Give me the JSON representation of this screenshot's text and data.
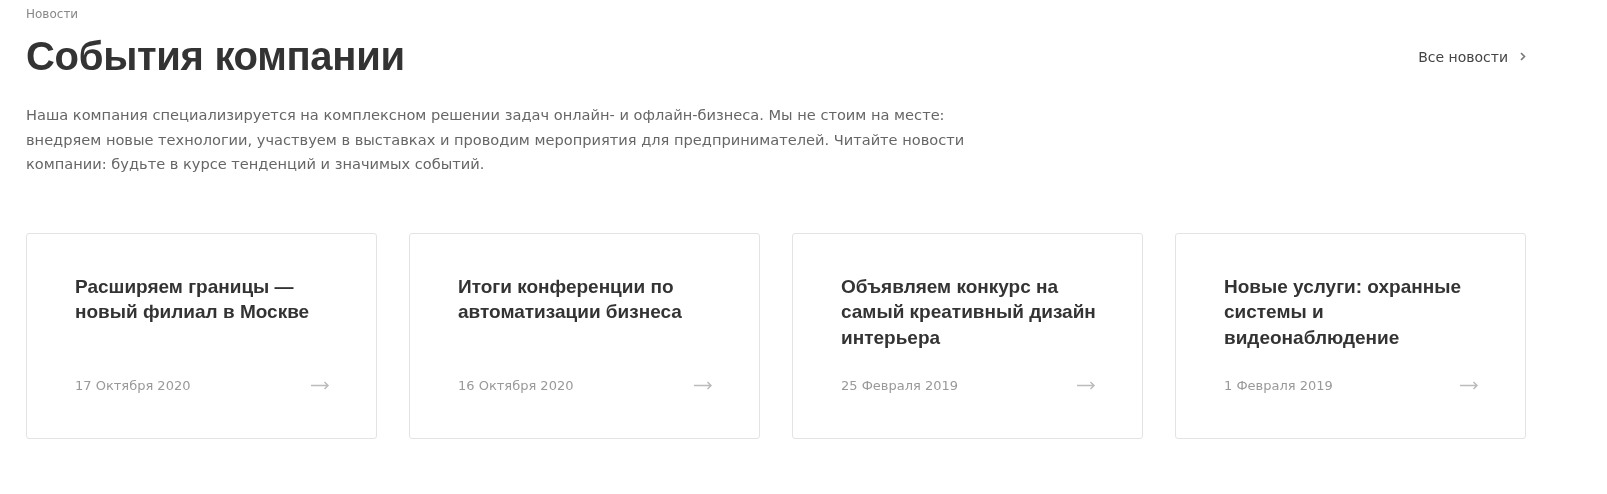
{
  "breadcrumb": "Новости",
  "title": "События компании",
  "all_news_link": "Все новости",
  "description": "Наша компания специализируется на комплексном решении задач онлайн- и офлайн-бизнеса. Мы не стоим на месте: внедряем новые технологии, участвуем в выставках и проводим мероприятия для предпринимателей. Читайте новости компании: будьте в курсе тенденций и значимых событий.",
  "news": [
    {
      "title": "Расширяем границы — новый филиал в Москве",
      "date": "17 Октября 2020"
    },
    {
      "title": "Итоги конференции по автоматизации бизнеса",
      "date": "16 Октября 2020"
    },
    {
      "title": "Объявляем конкурс на самый креативный дизайн интерьера",
      "date": "25 Февраля 2019"
    },
    {
      "title": "Новые услуги: охранные системы и видеонаблюдение",
      "date": "1 Февраля 2019"
    }
  ]
}
